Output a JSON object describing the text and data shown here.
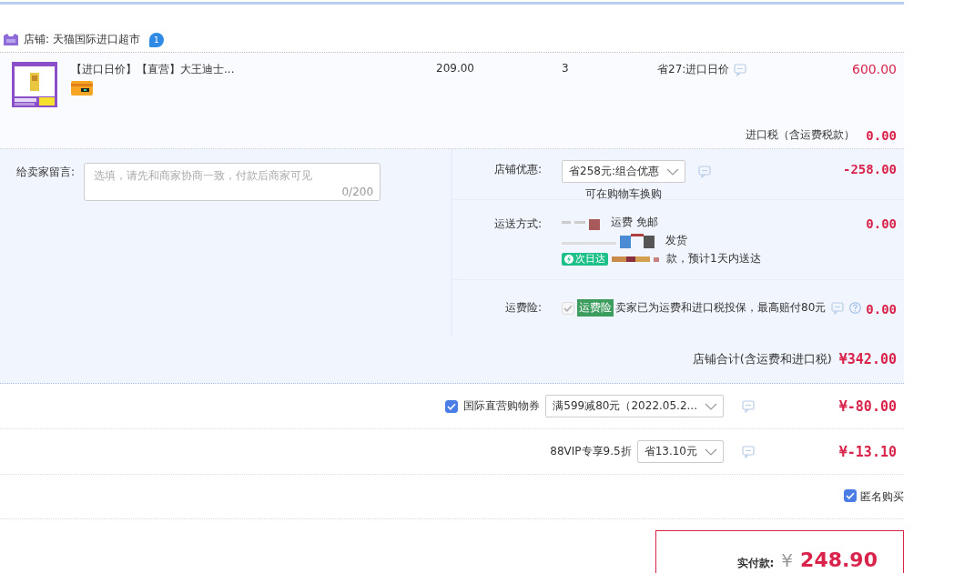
{
  "store": {
    "label": "店铺: 天猫国际进口超市",
    "badge": "1"
  },
  "item": {
    "kind": "picture",
    "title": "【进口日价】【直营】大王迪士...",
    "price": "209.00",
    "quantity": "3",
    "promo": "省27:进口日价",
    "subtotal": "600.00"
  },
  "import_tax": {
    "label": "进口税（含运费税款）",
    "value": "0.00"
  },
  "message": {
    "label": "给卖家留言:",
    "placeholder": "选填，请先和商家协商一致，付款后商家可见",
    "counter": "0/200"
  },
  "store_discount": {
    "label": "店铺优惠:",
    "select": "省258元:组合优惠",
    "note": "可在购物车换购",
    "value": "-258.00"
  },
  "shipping": {
    "label": "运送方式:",
    "line_1": "运费 免邮",
    "line_2": "发货",
    "badge": "次日达",
    "line_3": "款，预计1天内送达",
    "value": "0.00"
  },
  "insurance": {
    "label": "运费险:",
    "checked": true,
    "disabled": true,
    "tag": "运费险",
    "text": "卖家已为运费和进口税投保，最高赔付80元",
    "value": "0.00"
  },
  "store_total": {
    "label": "店铺合计(含运费和进口税)",
    "value": "¥342.00"
  },
  "discounts": [
    {
      "kind": "checkbox",
      "checked": true,
      "label": "国际直营购物券",
      "select": "满599减80元（2022.05.2...",
      "value": "¥-80.00"
    },
    {
      "kind": "plain",
      "label": "88VIP专享9.5折",
      "select": "省13.10元",
      "value": "¥-13.10"
    }
  ],
  "anonymous": {
    "label": "匿名购买",
    "checked": true
  },
  "payment": {
    "label": "实付款:",
    "currency": "¥",
    "amount": "248.90"
  }
}
